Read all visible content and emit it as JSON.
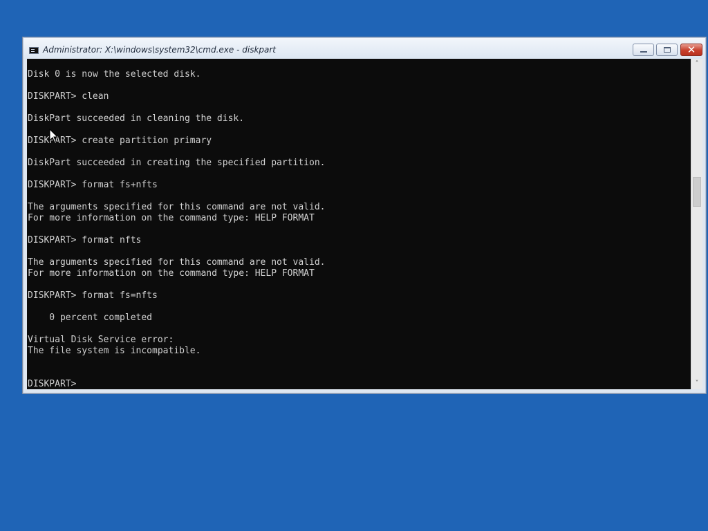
{
  "window": {
    "title": "Administrator: X:\\windows\\system32\\cmd.exe - diskpart",
    "icon": "command-prompt-icon",
    "controls": {
      "minimize": "minimize-icon",
      "maximize": "maximize-icon",
      "close": "✕"
    }
  },
  "console": {
    "lines": [
      "Disk 0 is now the selected disk.",
      "",
      "DISKPART> clean",
      "",
      "DiskPart succeeded in cleaning the disk.",
      "",
      "DISKPART> create partition primary",
      "",
      "DiskPart succeeded in creating the specified partition.",
      "",
      "DISKPART> format fs+nfts",
      "",
      "The arguments specified for this command are not valid.",
      "For more information on the command type: HELP FORMAT",
      "",
      "DISKPART> format nfts",
      "",
      "The arguments specified for this command are not valid.",
      "For more information on the command type: HELP FORMAT",
      "",
      "DISKPART> format fs=nfts",
      "",
      "    0 percent completed",
      "",
      "Virtual Disk Service error:",
      "The file system is incompatible.",
      "",
      "",
      "DISKPART>"
    ]
  },
  "scrollbar": {
    "up": "˄",
    "down": "˅"
  },
  "colors": {
    "desktop": "#1f64b6",
    "console_bg": "#0c0c0c",
    "console_text": "#d2d2d2",
    "close_button": "#c73f2c"
  }
}
